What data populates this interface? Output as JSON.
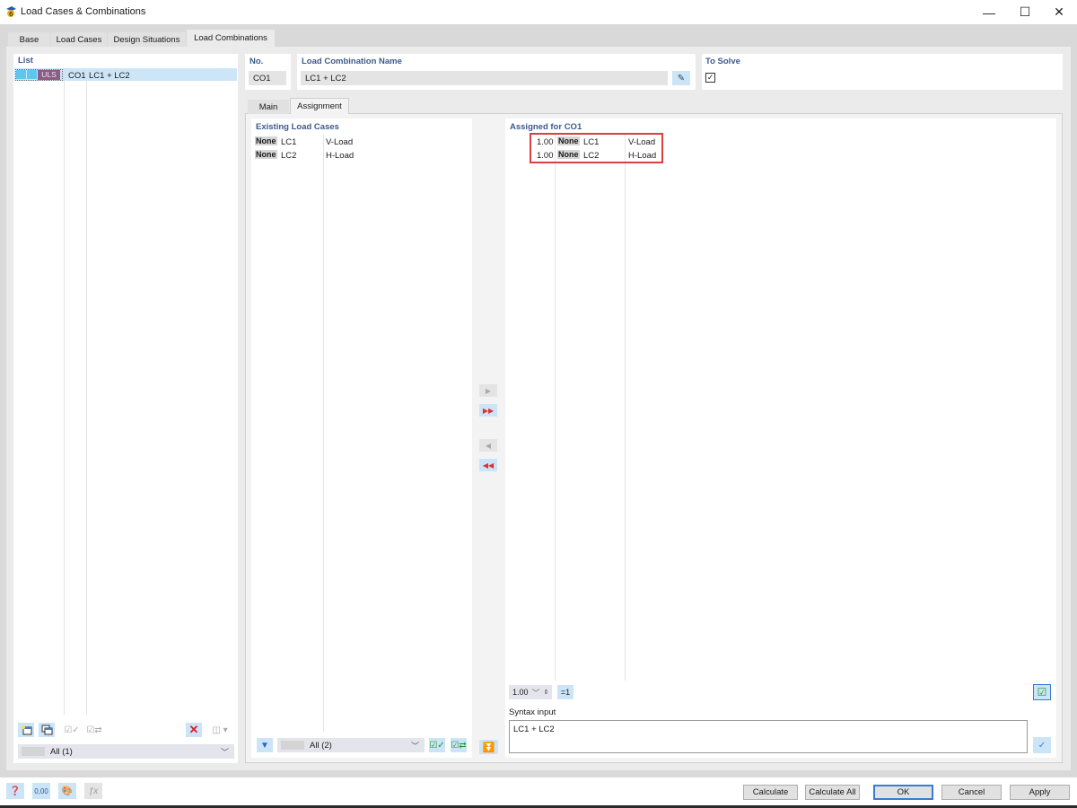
{
  "window": {
    "title": "Load Cases & Combinations",
    "minimize": "—",
    "maximize": "☐",
    "close": "✕"
  },
  "tabs": [
    {
      "label": "Base",
      "active": false
    },
    {
      "label": "Load Cases",
      "active": false
    },
    {
      "label": "Design Situations",
      "active": false
    },
    {
      "label": "Load Combinations",
      "active": true
    }
  ],
  "list": {
    "label": "List",
    "items": [
      {
        "badge": "ULS",
        "badge_color": "#8a5c86",
        "no": "CO1",
        "name": "LC1 + LC2",
        "selected": true
      }
    ],
    "filter": "All (1)"
  },
  "header": {
    "no_label": "No.",
    "no_value": "CO1",
    "name_label": "Load Combination Name",
    "name_value": "LC1 + LC2",
    "solve_label": "To Solve",
    "solve_checked": true
  },
  "subtabs": [
    {
      "label": "Main",
      "active": false
    },
    {
      "label": "Assignment",
      "active": true
    }
  ],
  "existing": {
    "label": "Existing Load Cases",
    "rows": [
      {
        "type": "None",
        "lc": "LC1",
        "desc": "V-Load"
      },
      {
        "type": "None",
        "lc": "LC2",
        "desc": "H-Load"
      }
    ],
    "filter": "All (2)"
  },
  "assigned": {
    "label": "Assigned for CO1",
    "rows": [
      {
        "factor": "1.00",
        "type": "None",
        "lc": "LC1",
        "desc": "V-Load"
      },
      {
        "factor": "1.00",
        "type": "None",
        "lc": "LC2",
        "desc": "H-Load"
      }
    ],
    "factor_value": "1.00",
    "set_one_label": "=1",
    "syntax_label": "Syntax input",
    "syntax_value": "LC1 + LC2"
  },
  "buttons": {
    "calculate": "Calculate",
    "calculate_all": "Calculate All",
    "ok": "OK",
    "cancel": "Cancel",
    "apply": "Apply"
  },
  "colors": {
    "accent": "#3c5a8c",
    "highlight": "#d9403f",
    "selection": "#cde6f7"
  }
}
